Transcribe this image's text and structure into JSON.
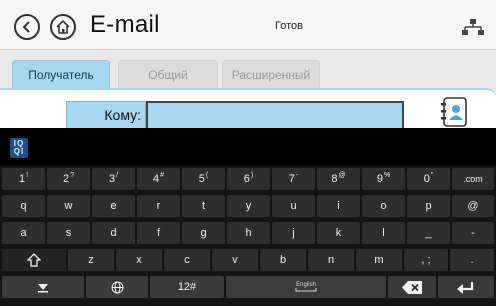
{
  "header": {
    "title": "E-mail",
    "status": "Готов"
  },
  "tabs": [
    {
      "label": "Получатель",
      "active": true
    },
    {
      "label": "Общий",
      "active": false
    },
    {
      "label": "Расширенный",
      "active": false
    }
  ],
  "recipient": {
    "label": "Кому:",
    "value": ""
  },
  "keyboard": {
    "ime_icon_text": [
      "IQ",
      "QI"
    ],
    "row1": [
      {
        "main": "1",
        "sup": "!"
      },
      {
        "main": "2",
        "sup": "?"
      },
      {
        "main": "3",
        "sup": "/"
      },
      {
        "main": "4",
        "sup": "#"
      },
      {
        "main": "5",
        "sup": "("
      },
      {
        "main": "6",
        "sup": ")"
      },
      {
        "main": "7",
        "sup": "-"
      },
      {
        "main": "8",
        "sup": "@"
      },
      {
        "main": "9",
        "sup": "%"
      },
      {
        "main": "0",
        "sup": "\""
      },
      {
        "main": ".com",
        "sup": ""
      }
    ],
    "row2": [
      "q",
      "w",
      "e",
      "r",
      "t",
      "y",
      "u",
      "i",
      "o",
      "p",
      "@"
    ],
    "row3": [
      "a",
      "s",
      "d",
      "f",
      "g",
      "h",
      "j",
      "k",
      "l",
      "_",
      "-"
    ],
    "row4": [
      "z",
      "x",
      "c",
      "v",
      "b",
      "n",
      "m",
      ", ;",
      "."
    ],
    "row4_sym": [
      "z",
      "x",
      "c",
      "v",
      "b",
      "n",
      "m"
    ],
    "bottom": {
      "numeric_label": "12#",
      "space_label": "English"
    }
  },
  "colors": {
    "accent": "#a8d8f0",
    "keyboard_bg": "#141414",
    "key_bg": "#2e2e2e"
  }
}
